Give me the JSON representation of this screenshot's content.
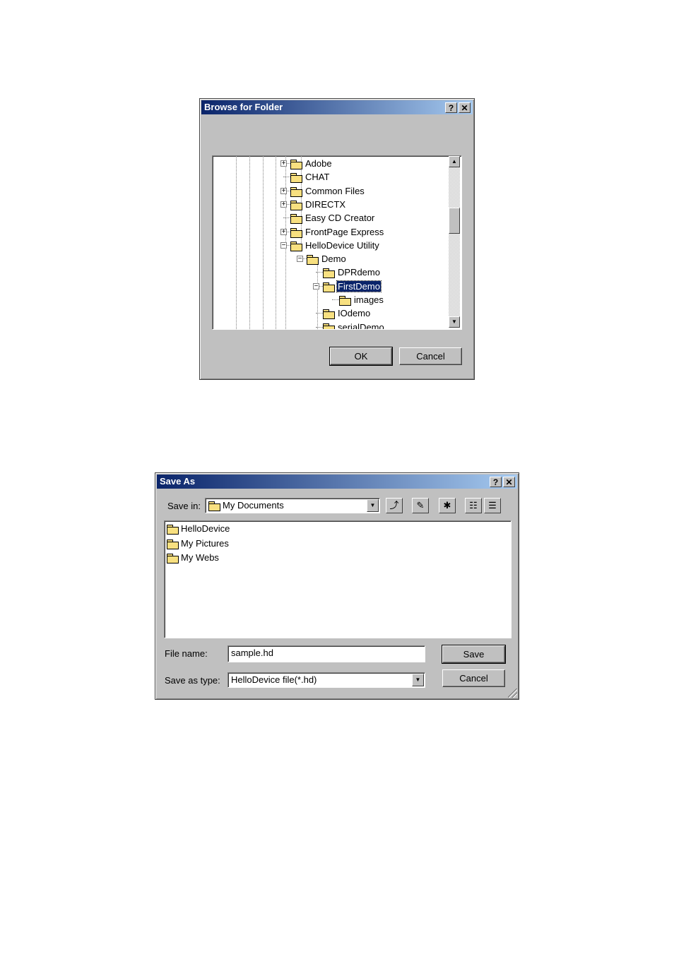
{
  "browse_dialog": {
    "title": "Browse for Folder",
    "help_label": "?",
    "close_label": "✕",
    "tree": [
      {
        "label": "Adobe",
        "expander": "+",
        "level": 0
      },
      {
        "label": "CHAT",
        "expander": "",
        "level": 0
      },
      {
        "label": "Common Files",
        "expander": "+",
        "level": 0
      },
      {
        "label": "DIRECTX",
        "expander": "+",
        "level": 0
      },
      {
        "label": "Easy CD Creator",
        "expander": "",
        "level": 0
      },
      {
        "label": "FrontPage Express",
        "expander": "+",
        "level": 0
      },
      {
        "label": "HelloDevice Utility",
        "expander": "−",
        "level": 0
      },
      {
        "label": "Demo",
        "expander": "−",
        "level": 1
      },
      {
        "label": "DPRdemo",
        "expander": "",
        "level": 2
      },
      {
        "label": "FirstDemo",
        "expander": "−",
        "level": 2,
        "selected": true
      },
      {
        "label": "images",
        "expander": "",
        "level": 3
      },
      {
        "label": "IOdemo",
        "expander": "",
        "level": 2
      },
      {
        "label": "serialDemo",
        "expander": "",
        "level": 2
      }
    ],
    "ok_label": "OK",
    "cancel_label": "Cancel"
  },
  "save_dialog": {
    "title": "Save As",
    "help_label": "?",
    "close_label": "✕",
    "save_in_label": "Save in:",
    "save_in_value": "My Documents",
    "files": [
      "HelloDevice",
      "My Pictures",
      "My Webs"
    ],
    "file_name_label": "File name:",
    "file_name_value": "sample.hd",
    "save_type_label": "Save as type:",
    "save_type_value": "HelloDevice file(*.hd)",
    "save_label": "Save",
    "cancel_label": "Cancel"
  }
}
